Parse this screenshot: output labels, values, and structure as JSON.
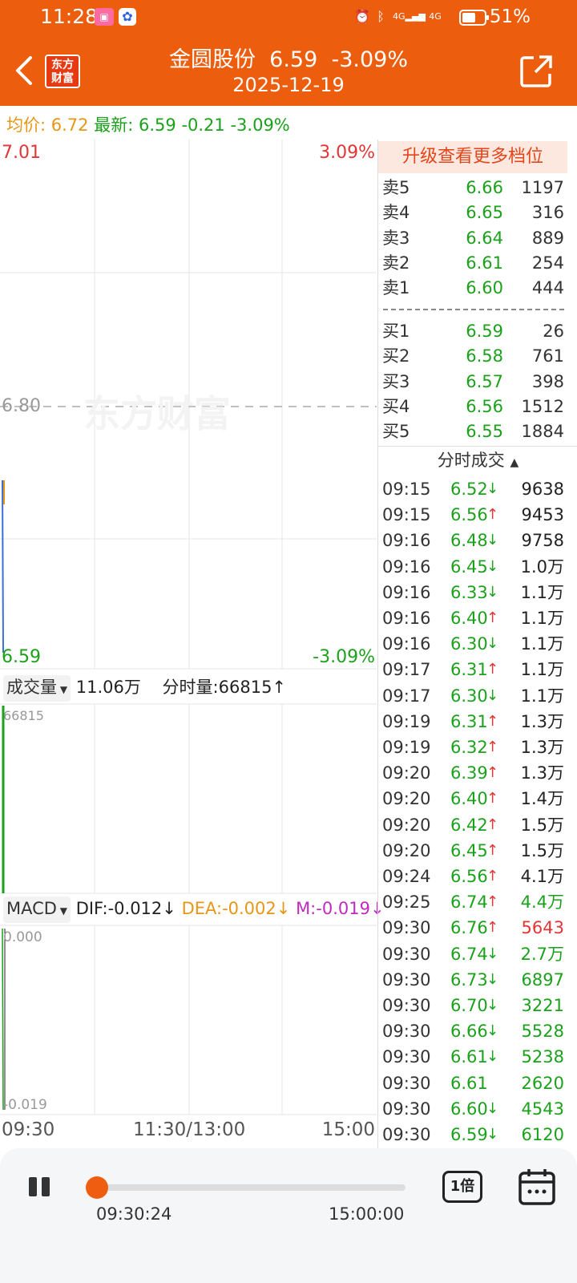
{
  "status_bar": {
    "time": "11:28",
    "battery": "51%",
    "network": "4G"
  },
  "header": {
    "stock_name": "金圆股份",
    "price": "6.59",
    "change_pct": "-3.09%",
    "date": "2025-12-19",
    "logo_text": "东方财富"
  },
  "quote": {
    "avg_label": "均价:",
    "avg": "6.72",
    "latest_label": "最新:",
    "latest": "6.59",
    "change": "-0.21",
    "change_pct": "-3.09%"
  },
  "chart": {
    "max_price": "7.01",
    "max_pct": "3.09%",
    "min_price": "6.59",
    "min_pct": "-3.09%",
    "mid_price": "6.80",
    "watermark": "东方财富",
    "volume_selector": "成交量",
    "volume_total": "11.06万",
    "volume_tick_label": "分时量:66815↑",
    "volume_max": "66815",
    "macd_selector": "MACD",
    "dif": "DIF:-0.012↓",
    "dea": "DEA:-0.002↓",
    "m": "M:-0.019↓",
    "macd_top": "0.000",
    "macd_bottom": "-0.019",
    "x_axis": [
      "09:30",
      "11:30/13:00",
      "15:00"
    ]
  },
  "order_book": {
    "upgrade_label": "升级查看更多档位",
    "sells": [
      {
        "label": "卖5",
        "price": "6.66",
        "vol": "1197"
      },
      {
        "label": "卖4",
        "price": "6.65",
        "vol": "316"
      },
      {
        "label": "卖3",
        "price": "6.64",
        "vol": "889"
      },
      {
        "label": "卖2",
        "price": "6.61",
        "vol": "254"
      },
      {
        "label": "卖1",
        "price": "6.60",
        "vol": "444"
      }
    ],
    "buys": [
      {
        "label": "买1",
        "price": "6.59",
        "vol": "26"
      },
      {
        "label": "买2",
        "price": "6.58",
        "vol": "761"
      },
      {
        "label": "买3",
        "price": "6.57",
        "vol": "398"
      },
      {
        "label": "买4",
        "price": "6.56",
        "vol": "1512"
      },
      {
        "label": "买5",
        "price": "6.55",
        "vol": "1884"
      }
    ]
  },
  "ticks_title": "分时成交",
  "ticks": [
    {
      "time": "09:15",
      "price": "6.52",
      "dir": "↓",
      "vol": "9638",
      "vcolor": "#222222"
    },
    {
      "time": "09:15",
      "price": "6.56",
      "dir": "↑",
      "vol": "9453",
      "vcolor": "#222222"
    },
    {
      "time": "09:16",
      "price": "6.48",
      "dir": "↓",
      "vol": "9758",
      "vcolor": "#222222"
    },
    {
      "time": "09:16",
      "price": "6.45",
      "dir": "↓",
      "vol": "1.0万",
      "vcolor": "#222222"
    },
    {
      "time": "09:16",
      "price": "6.33",
      "dir": "↓",
      "vol": "1.1万",
      "vcolor": "#222222"
    },
    {
      "time": "09:16",
      "price": "6.40",
      "dir": "↑",
      "vol": "1.1万",
      "vcolor": "#222222"
    },
    {
      "time": "09:16",
      "price": "6.30",
      "dir": "↓",
      "vol": "1.1万",
      "vcolor": "#222222"
    },
    {
      "time": "09:17",
      "price": "6.31",
      "dir": "↑",
      "vol": "1.1万",
      "vcolor": "#222222"
    },
    {
      "time": "09:17",
      "price": "6.30",
      "dir": "↓",
      "vol": "1.1万",
      "vcolor": "#222222"
    },
    {
      "time": "09:19",
      "price": "6.31",
      "dir": "↑",
      "vol": "1.3万",
      "vcolor": "#222222"
    },
    {
      "time": "09:19",
      "price": "6.32",
      "dir": "↑",
      "vol": "1.3万",
      "vcolor": "#222222"
    },
    {
      "time": "09:20",
      "price": "6.39",
      "dir": "↑",
      "vol": "1.3万",
      "vcolor": "#222222"
    },
    {
      "time": "09:20",
      "price": "6.40",
      "dir": "↑",
      "vol": "1.4万",
      "vcolor": "#222222"
    },
    {
      "time": "09:20",
      "price": "6.42",
      "dir": "↑",
      "vol": "1.5万",
      "vcolor": "#222222"
    },
    {
      "time": "09:20",
      "price": "6.45",
      "dir": "↑",
      "vol": "1.5万",
      "vcolor": "#222222"
    },
    {
      "time": "09:24",
      "price": "6.56",
      "dir": "↑",
      "vol": "4.1万",
      "vcolor": "#222222"
    },
    {
      "time": "09:25",
      "price": "6.74",
      "dir": "↑",
      "vol": "4.4万",
      "vcolor": "#1ba11b"
    },
    {
      "time": "09:30",
      "price": "6.76",
      "dir": "↑",
      "vol": "5643",
      "vcolor": "#e23636"
    },
    {
      "time": "09:30",
      "price": "6.74",
      "dir": "↓",
      "vol": "2.7万",
      "vcolor": "#1ba11b"
    },
    {
      "time": "09:30",
      "price": "6.73",
      "dir": "↓",
      "vol": "6897",
      "vcolor": "#1ba11b"
    },
    {
      "time": "09:30",
      "price": "6.70",
      "dir": "↓",
      "vol": "3221",
      "vcolor": "#1ba11b"
    },
    {
      "time": "09:30",
      "price": "6.66",
      "dir": "↓",
      "vol": "5528",
      "vcolor": "#1ba11b"
    },
    {
      "time": "09:30",
      "price": "6.61",
      "dir": "↓",
      "vol": "5238",
      "vcolor": "#1ba11b"
    },
    {
      "time": "09:30",
      "price": "6.61",
      "dir": "",
      "vol": "2620",
      "vcolor": "#1ba11b"
    },
    {
      "time": "09:30",
      "price": "6.60",
      "dir": "↓",
      "vol": "4543",
      "vcolor": "#1ba11b"
    },
    {
      "time": "09:30",
      "price": "6.59",
      "dir": "↓",
      "vol": "6120",
      "vcolor": "#1ba11b"
    }
  ],
  "player": {
    "current": "09:30:24",
    "end": "15:00:00",
    "speed": "1倍",
    "progress": 0.0
  },
  "colors": {
    "brand": "#ec5d0e",
    "up": "#e23636",
    "down": "#1ba11b",
    "avg": "#e79617"
  }
}
